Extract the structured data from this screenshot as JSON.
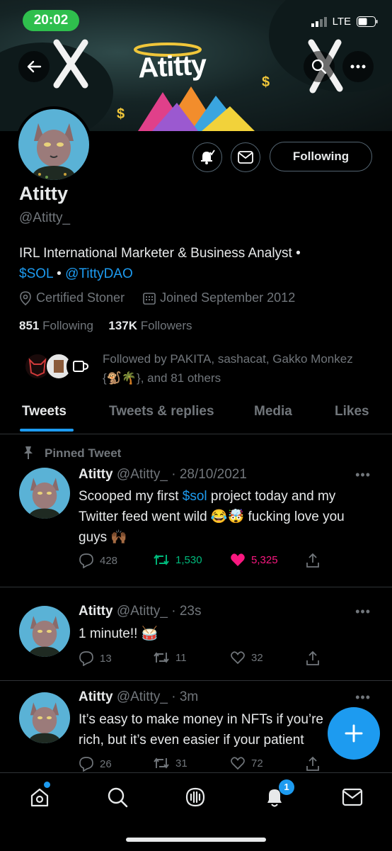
{
  "status_bar": {
    "time": "20:02",
    "network": "LTE"
  },
  "banner": {
    "art_text": "Atitty"
  },
  "profile": {
    "name": "Atitty",
    "handle": "@Atitty_",
    "bio_line1": "IRL International Marketer & Business Analyst •",
    "bio_sol": "$SOL",
    "bio_sep": " • ",
    "bio_dao": "@TittyDAO",
    "location": "Certified Stoner",
    "joined": "Joined September 2012",
    "following_count": "851",
    "following_label": "Following",
    "followers_count": "137K",
    "followers_label": "Followers",
    "followed_by": "Followed by PAKITA, sashacat, Gakko Monkez {🐒🌴}, and 81 others",
    "following_button": "Following"
  },
  "tabs": [
    {
      "label": "Tweets"
    },
    {
      "label": "Tweets & replies"
    },
    {
      "label": "Media"
    },
    {
      "label": "Likes"
    }
  ],
  "pinned_label": "Pinned Tweet",
  "tweets": [
    {
      "name": "Atitty",
      "meta": "@Atitty_ · 28/10/2021",
      "text_a": "Scooped my first ",
      "text_link": "$sol",
      "text_b": " project today and my Twitter feed went wild 😂🤯 fucking love you guys 🙌🏾",
      "replies": "428",
      "retweets": "1,530",
      "likes": "5,325"
    },
    {
      "name": "Atitty",
      "meta": "@Atitty_ · 23s",
      "text": "1 minute!! 🥁",
      "replies": "13",
      "retweets": "11",
      "likes": "32"
    },
    {
      "name": "Atitty",
      "meta": "@Atitty_ · 3m",
      "text": "It’s easy to make money in NFTs if you’re rich, but it’s even easier if your patient",
      "replies": "26",
      "retweets": "31",
      "likes": "72"
    }
  ],
  "bottom_nav": {
    "notification_badge": "1"
  },
  "colors": {
    "accent": "#1d9bf0",
    "like": "#f91880",
    "retweet": "#00ba7c",
    "muted": "#71767b"
  }
}
